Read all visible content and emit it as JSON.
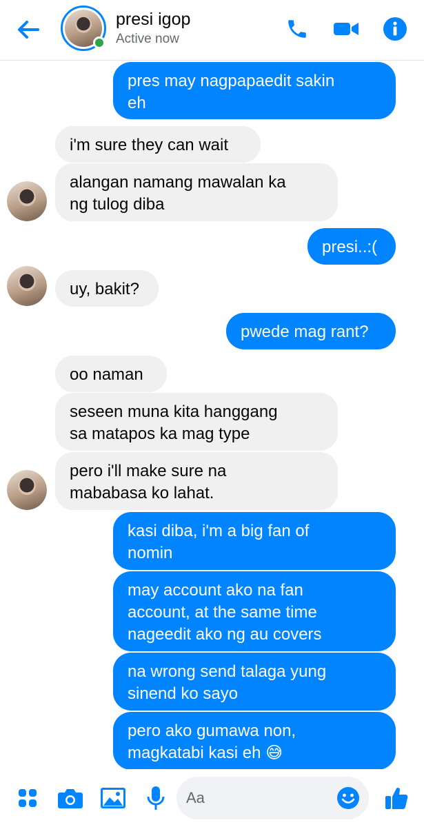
{
  "header": {
    "name": "presi igop",
    "status": "Active now"
  },
  "messages": [
    {
      "dir": "out",
      "text": "pres may nagpapaedit sakin\neh"
    },
    {
      "dir": "in",
      "text": "i'm sure they can wait"
    },
    {
      "dir": "in",
      "text": "alangan namang mawalan ka\nng tulog diba"
    },
    {
      "dir": "out",
      "text": "presi..:("
    },
    {
      "dir": "in",
      "text": "uy, bakit?"
    },
    {
      "dir": "out",
      "text": "pwede mag rant?"
    },
    {
      "dir": "in",
      "text": "oo naman"
    },
    {
      "dir": "in",
      "text": "seseen muna kita hanggang\nsa matapos ka mag type"
    },
    {
      "dir": "in",
      "text": "pero i'll make sure na\nmababasa ko lahat."
    },
    {
      "dir": "out",
      "text": "kasi diba, i'm a big fan of\nnomin"
    },
    {
      "dir": "out",
      "text": "may account ako na fan\naccount, at the same time\nnageedit ako ng au covers"
    },
    {
      "dir": "out",
      "text": "na wrong send talaga yung\nsinend ko sayo"
    },
    {
      "dir": "out",
      "text": "pero ako gumawa non,\nmagkatabi kasi eh 😅"
    }
  ],
  "composer": {
    "placeholder": "Aa"
  },
  "colors": {
    "accent": "#0084ff",
    "incoming_bubble": "#f0f0f0",
    "online": "#31a24c"
  },
  "icons": [
    "back-arrow-icon",
    "phone-icon",
    "video-camera-icon",
    "info-icon",
    "apps-grid-icon",
    "camera-icon",
    "gallery-icon",
    "microphone-icon",
    "emoji-icon",
    "thumbs-up-icon"
  ]
}
